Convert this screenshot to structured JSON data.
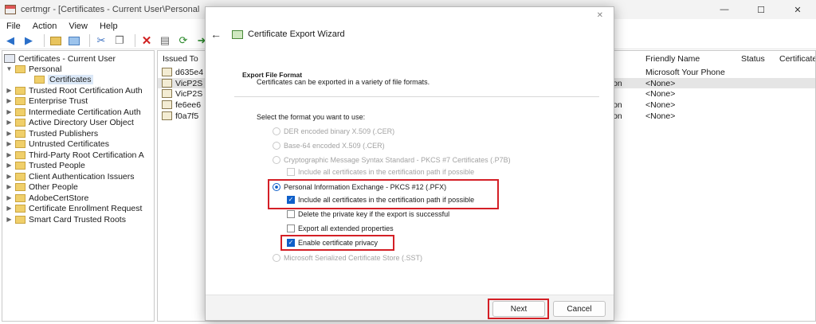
{
  "window": {
    "title": "certmgr - [Certificates - Current User\\Personal",
    "min": "—",
    "max": "☐",
    "close": "✕"
  },
  "menu": [
    "File",
    "Action",
    "View",
    "Help"
  ],
  "tree": {
    "root": "Certificates - Current User",
    "personal": "Personal",
    "personal_child": "Certificates",
    "items": [
      "Trusted Root Certification Auth",
      "Enterprise Trust",
      "Intermediate Certification Auth",
      "Active Directory User Object",
      "Trusted Publishers",
      "Untrusted Certificates",
      "Third-Party Root Certification A",
      "Trusted People",
      "Client Authentication Issuers",
      "Other People",
      "AdobeCertStore",
      "Certificate Enrollment Request",
      "Smart Card Trusted Roots"
    ]
  },
  "list": {
    "headers": {
      "issued_to": "Issued To",
      "purposes": "es",
      "friendly_name": "Friendly Name",
      "status": "Status",
      "template": "Certificate"
    },
    "rows": [
      {
        "issued_to": "d635e4",
        "purposes": "",
        "friendly_name": "Microsoft Your Phone"
      },
      {
        "issued_to": "VicP2S",
        "purposes": "ation",
        "friendly_name": "<None>"
      },
      {
        "issued_to": "VicP2S",
        "purposes": "",
        "friendly_name": "<None>"
      },
      {
        "issued_to": "fe6ee6",
        "purposes": "ation",
        "friendly_name": "<None>"
      },
      {
        "issued_to": "f0a7f5",
        "purposes": "ation",
        "friendly_name": "<None>"
      }
    ]
  },
  "dialog": {
    "title": "Certificate Export Wizard",
    "close": "✕",
    "back": "←",
    "section_title": "Export File Format",
    "section_desc": "Certificates can be exported in a variety of file formats.",
    "prompt": "Select the format you want to use:",
    "options": {
      "der": "DER encoded binary X.509 (.CER)",
      "base64": "Base-64 encoded X.509 (.CER)",
      "pkcs7": "Cryptographic Message Syntax Standard - PKCS #7 Certificates (.P7B)",
      "pkcs7_include": "Include all certificates in the certification path if possible",
      "pfx": "Personal Information Exchange - PKCS #12 (.PFX)",
      "pfx_include": "Include all certificates in the certification path if possible",
      "pfx_delete": "Delete the private key if the export is successful",
      "pfx_export_props": "Export all extended properties",
      "pfx_privacy": "Enable certificate privacy",
      "sst": "Microsoft Serialized Certificate Store (.SST)"
    },
    "buttons": {
      "next": "Next",
      "cancel": "Cancel"
    }
  },
  "colors": {
    "accent": "#0f5fc9",
    "highlight_box": "#d41f26"
  }
}
